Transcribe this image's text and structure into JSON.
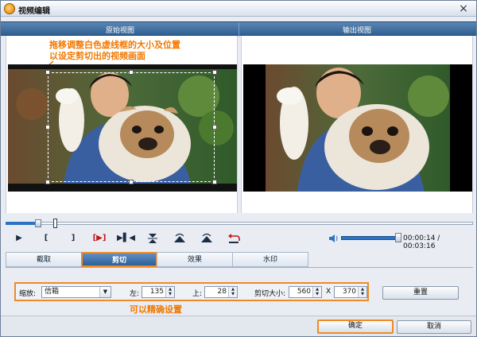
{
  "window": {
    "title": "视频编辑",
    "close_glyph": "×"
  },
  "views": {
    "left_label": "原始视图",
    "right_label": "输出视图"
  },
  "hint_drag": {
    "line1": "拖移调整白色虚线框的大小及位置",
    "line2": "以设定剪切出的视频画面"
  },
  "timeline": {
    "position_fraction": 0.07,
    "mark_fraction": 0.105
  },
  "controls": {
    "play_glyph": "▶",
    "mark_in_glyph": "[",
    "mark_out_glyph": "]",
    "clip_glyph": "[▶]",
    "step_glyph": "▶▌◀",
    "volume_fraction": 1.0,
    "time": "00:00:14 / 00:03:16"
  },
  "tabs": [
    {
      "label": "截取",
      "active": false
    },
    {
      "label": "剪切",
      "active": true
    },
    {
      "label": "效果",
      "active": false
    },
    {
      "label": "水印",
      "active": false
    }
  ],
  "settings": {
    "zoom_label": "缩放:",
    "zoom_value": "信箱",
    "left_label": "左:",
    "left_value": "135",
    "top_label": "上:",
    "top_value": "28",
    "size_label": "剪切大小:",
    "width_value": "560",
    "x_label": "X",
    "height_value": "370",
    "reset_label": "重置"
  },
  "hint_precise": "可以精确设置",
  "footer": {
    "ok_label": "确定",
    "cancel_label": "取消"
  },
  "colors": {
    "accent_orange": "#f08a24",
    "header_blue": "#2f5f92",
    "progress_blue": "#2d73c3"
  }
}
